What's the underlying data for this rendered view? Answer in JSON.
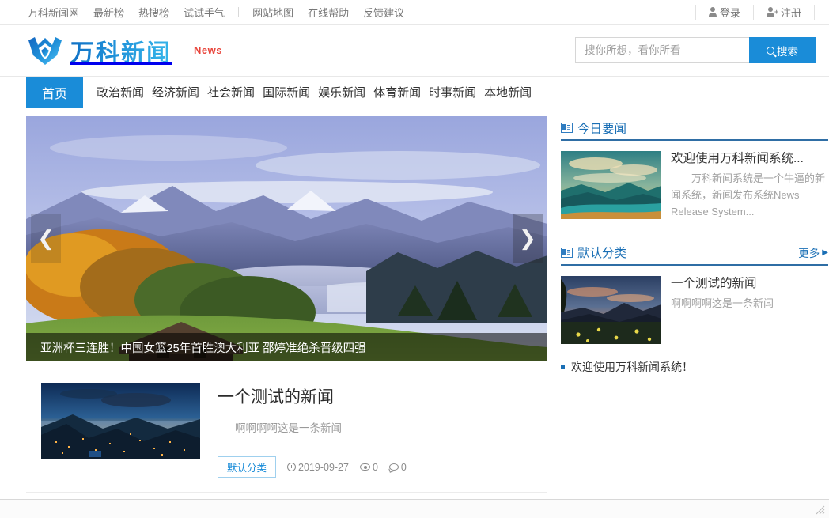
{
  "topbar": {
    "left_links": [
      {
        "label": "万科新闻网"
      },
      {
        "label": "最新榜"
      },
      {
        "label": "热搜榜"
      },
      {
        "label": "试试手气"
      },
      {
        "label": "网站地图"
      },
      {
        "label": "在线帮助"
      },
      {
        "label": "反馈建议"
      }
    ],
    "login_label": "登录",
    "register_label": "注册"
  },
  "header": {
    "logo_text": "万科新闻",
    "logo_sub": "News",
    "logo_icon": "crown-w-logo-icon"
  },
  "search": {
    "placeholder": "搜你所想，看你所看",
    "value": "",
    "button_label": "搜索",
    "button_icon": "search-icon"
  },
  "nav": {
    "home_label": "首页",
    "items": [
      {
        "label": "政治新闻"
      },
      {
        "label": "经济新闻"
      },
      {
        "label": "社会新闻"
      },
      {
        "label": "国际新闻"
      },
      {
        "label": "娱乐新闻"
      },
      {
        "label": "体育新闻"
      },
      {
        "label": "时事新闻"
      },
      {
        "label": "本地新闻"
      }
    ]
  },
  "carousel": {
    "caption": "亚洲杯三连胜！中国女篮25年首胜澳大利亚 邵婷准绝杀晋级四强",
    "prev_icon": "chevron-left-icon",
    "next_icon": "chevron-right-icon",
    "prev_glyph": "❮",
    "next_glyph": "❯"
  },
  "main_articles": [
    {
      "title": "一个测试的新闻",
      "desc": "啊啊啊啊这是一条新闻",
      "category": "默认分类",
      "date": "2019-09-27",
      "views": "0",
      "comments": "0",
      "thumb_alt": "coastal-town-dusk-photo"
    }
  ],
  "sidebar": {
    "blocks": [
      {
        "title": "今日要闻",
        "icon": "news-list-icon",
        "more_label": "",
        "has_more": false,
        "feature": {
          "title": "欢迎使用万科新闻系统...",
          "desc": "万科新闻系统是一个牛逼的新闻系统，新闻发布系统News Release System...",
          "thumb_alt": "teal-gold-sunset-landscape"
        },
        "links": []
      },
      {
        "title": "默认分类",
        "icon": "news-list-icon",
        "more_label": "更多",
        "more_glyph": "▶",
        "has_more": true,
        "feature": {
          "title": "一个测试的新闻",
          "desc": "啊啊啊啊这是一条新闻",
          "thumb_alt": "meadow-sunset-flowers"
        },
        "links": [
          {
            "label": "欢迎使用万科新闻系统！"
          }
        ]
      }
    ]
  },
  "colors": {
    "accent": "#1a8cd8",
    "heading": "#1a6fb5",
    "brand_red": "#e8443a",
    "text": "#333333",
    "muted": "#9a9a9a"
  }
}
